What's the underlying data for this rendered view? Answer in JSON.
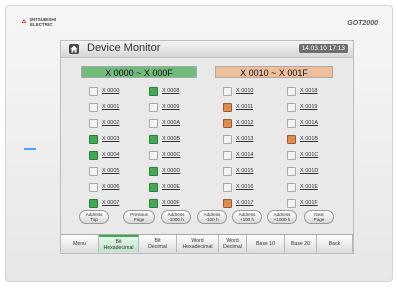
{
  "brand": {
    "line1": "MITSUBISHI",
    "line2": "ELECTRIC",
    "model": "GOT2000"
  },
  "screen": {
    "title": "Device Monitor",
    "clock": "14.03.10 17:13",
    "groups": [
      {
        "header": "X 0000 ~ X 000F",
        "color": "g",
        "columns": [
          [
            {
              "label": "X 0000",
              "state": "w"
            },
            {
              "label": "X 0001",
              "state": "w"
            },
            {
              "label": "X 0002",
              "state": "w"
            },
            {
              "label": "X 0003",
              "state": "g"
            },
            {
              "label": "X 0004",
              "state": "g"
            },
            {
              "label": "X 0005",
              "state": "w"
            },
            {
              "label": "X 0006",
              "state": "w"
            },
            {
              "label": "X 0007",
              "state": "g"
            }
          ],
          [
            {
              "label": "X 0008",
              "state": "g"
            },
            {
              "label": "X 0009",
              "state": "w"
            },
            {
              "label": "X 000A",
              "state": "w"
            },
            {
              "label": "X 000B",
              "state": "g"
            },
            {
              "label": "X 000C",
              "state": "w"
            },
            {
              "label": "X 000D",
              "state": "g"
            },
            {
              "label": "X 000E",
              "state": "g"
            },
            {
              "label": "X 000F",
              "state": "g"
            }
          ]
        ]
      },
      {
        "header": "X 0010 ~ X 001F",
        "color": "o",
        "columns": [
          [
            {
              "label": "X 0010",
              "state": "w"
            },
            {
              "label": "X 0011",
              "state": "o"
            },
            {
              "label": "X 0012",
              "state": "o"
            },
            {
              "label": "X 0013",
              "state": "w"
            },
            {
              "label": "X 0014",
              "state": "w"
            },
            {
              "label": "X 0015",
              "state": "w"
            },
            {
              "label": "X 0016",
              "state": "w"
            },
            {
              "label": "X 0017",
              "state": "o"
            }
          ],
          [
            {
              "label": "X 0018",
              "state": "w"
            },
            {
              "label": "X 0019",
              "state": "w"
            },
            {
              "label": "X 001A",
              "state": "w"
            },
            {
              "label": "X 001B",
              "state": "o"
            },
            {
              "label": "X 001C",
              "state": "w"
            },
            {
              "label": "X 001D",
              "state": "w"
            },
            {
              "label": "X 001E",
              "state": "w"
            },
            {
              "label": "X 001F",
              "state": "w"
            }
          ]
        ]
      }
    ],
    "nav": [
      {
        "l1": "Address",
        "l2": "Top"
      },
      {
        "l1": "Previous",
        "l2": "Page"
      },
      {
        "l1": "Address",
        "l2": "-1000 h"
      },
      {
        "l1": "Address",
        "l2": "-100 h"
      },
      {
        "l1": "Address",
        "l2": "+100 h"
      },
      {
        "l1": "Address",
        "l2": "+1000 h"
      },
      {
        "l1": "Next",
        "l2": "Page"
      }
    ],
    "menu": [
      {
        "l1": "Menu",
        "l2": ""
      },
      {
        "l1": "Bit",
        "l2": "Hexadecimal"
      },
      {
        "l1": "Bit",
        "l2": "Decimal"
      },
      {
        "l1": "Word",
        "l2": "Hexadecimal"
      },
      {
        "l1": "Word",
        "l2": "Decimal"
      },
      {
        "l1": "Base 10",
        "l2": ""
      },
      {
        "l1": "Base 20",
        "l2": ""
      },
      {
        "l1": "Back",
        "l2": ""
      }
    ],
    "active_menu_index": 1
  }
}
